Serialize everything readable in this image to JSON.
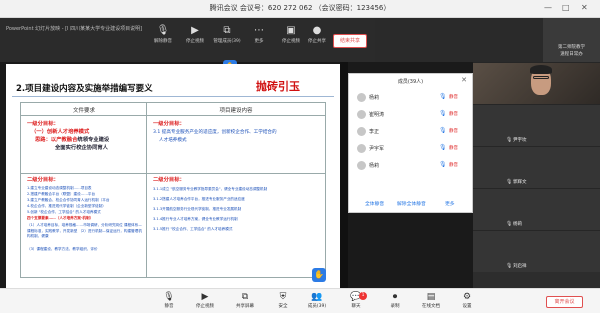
{
  "window": {
    "title": "腾讯会议 会议号：620 272 062 （会议密码：123456）",
    "meeting_id_label": "会议号：620 272 062",
    "password_label": "（会议密码：123456）"
  },
  "share_bar": {
    "source_info": "PowerPoint 幻灯片放映 - [Ⅰ 四川某某大学专业建设项目说明]",
    "tools": [
      {
        "icon": "mic-icon",
        "label": "解除静音"
      },
      {
        "icon": "video-icon",
        "label": "停止视频"
      },
      {
        "icon": "share-icon",
        "label": "管理成员(39)"
      },
      {
        "icon": "record-icon",
        "label": "管理成员(39)"
      },
      {
        "icon": "more-icon",
        "label": "更多"
      },
      {
        "icon": "camera-icon",
        "label": "停止视频"
      },
      {
        "icon": "record-icon",
        "label": "停止共享"
      }
    ],
    "end_share_label": "结束共享"
  },
  "top_thumb": {
    "name_line1": "第二师院教学",
    "name_line2": "遠程日常办"
  },
  "slide": {
    "heading": "2.项目建设内容及实施举措编写要义",
    "highlight": "抛砖引玉",
    "columns": [
      "文件要求",
      "项目建设内容"
    ],
    "left_l1": {
      "label": "一级分目标：",
      "item": "（一）创新人才培养模式",
      "idea_prefix": "思路：以产",
      "idea_highlight": "教融合",
      "idea_suffix": "统领专业建设",
      "idea_tail": "全面实行校企协同育人"
    },
    "left_l2": {
      "label": "二级分目标：",
      "items": [
        "1.建立专业建设动态调整机制……项目表",
        "2.搭建产教融合平台（联盟）建设……平台",
        "3.建立产教融合、校企合作协同育人运行机制（平台",
        "4.校企合作，推进现代学徒制（企业新型学徒制）",
        "5.创新 \"校企合作、工学结合\" 的人才培养模式",
        "四个支撑要素……（人才培养方案-机制）"
      ],
      "notes": "（1）人才培养目标，培养规格……市场调研，分析研究岗位 课程体系—课程标准，实践教学，开发新型 （2）进行机制—保证运行，构建管理机构机制，健康",
      "notes_tail": "（3）课程建设、教学方法、教学组织、评价"
    },
    "right_l1": {
      "label": "一级分目标：",
      "line1": "3.1 提高专业服务产业的适应度，创新校企合作、工学结合的",
      "line2": "人才培养模式"
    },
    "right_l2": {
      "label": "二级分目标：",
      "items": [
        "3.1.1成立 \"航空服务专业教学指导委员会\"，健全专业建设动态调整机制",
        "3.1.2搭建人才培养合作平台，推进专业服务产业的适应度",
        "3.1.3开展航空服务行业现代学徒制，推进专业发展机制",
        "3.1.4推行专业人才培养方案，健全专业教学运行机制",
        "3.1.5推行 \"校企合作、工学结合\" 的人才培养模式"
      ]
    }
  },
  "participants_panel": {
    "title": "成员(39人)",
    "members": [
      {
        "name": "杨莉",
        "status": "静音"
      },
      {
        "name": "崔明涛",
        "status": "静音"
      },
      {
        "name": "李正",
        "status": "静音"
      },
      {
        "name": "尹宇军",
        "status": "静音"
      },
      {
        "name": "杨莉",
        "status": "静音"
      }
    ],
    "buttons": [
      "全体静音",
      "解除全体静音",
      "更多"
    ]
  },
  "video_column": {
    "tiles": [
      {
        "name": "",
        "type": "camera"
      },
      {
        "name": "尹宇坎",
        "type": "avatar"
      },
      {
        "name": "郭辉文",
        "type": "avatar"
      },
      {
        "name": "杨莉",
        "type": "avatar"
      },
      {
        "name": "刘启祥",
        "type": "avatar"
      }
    ]
  },
  "bottom_bar": {
    "tools": [
      {
        "icon": "mic-icon",
        "label": "静音"
      },
      {
        "icon": "video-icon",
        "label": "停止视频"
      },
      {
        "icon": "share-icon",
        "label": "共享屏幕"
      },
      {
        "icon": "security-icon",
        "label": "安全"
      },
      {
        "icon": "members-icon",
        "label": "成员(39)"
      },
      {
        "icon": "chat-icon",
        "label": "聊天",
        "badge": "1"
      },
      {
        "icon": "record-icon",
        "label": "录制"
      },
      {
        "icon": "document-icon",
        "label": "在线文档"
      },
      {
        "icon": "settings-icon",
        "label": "设置"
      }
    ],
    "leave_label": "离开会议"
  },
  "colors": {
    "accent": "#2c7be5",
    "danger": "#e05050",
    "slide_red": "#d22222",
    "slide_blue": "#1a4fb8"
  }
}
